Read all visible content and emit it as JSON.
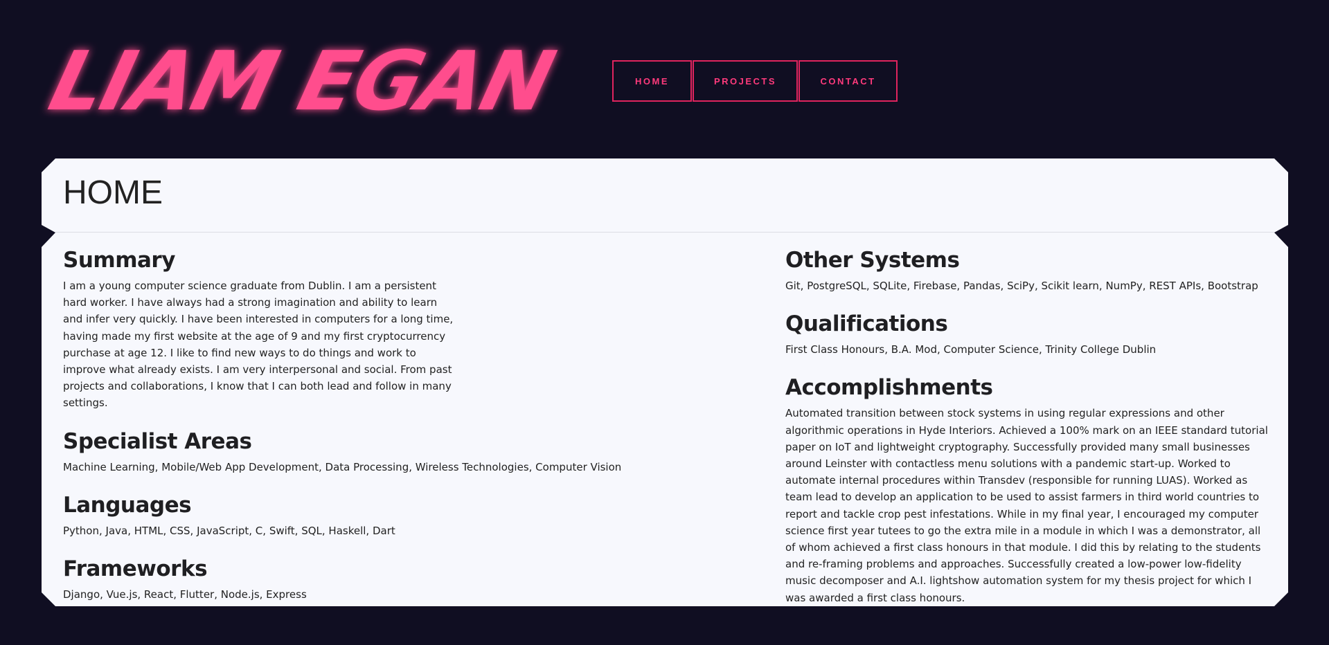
{
  "brand": {
    "logo_text": "LIAM EGAN",
    "logo_color": "#ff4d8d"
  },
  "nav": {
    "items": [
      {
        "label": "HOME"
      },
      {
        "label": "PROJECTS"
      },
      {
        "label": "CONTACT"
      }
    ],
    "accent": "#e0245e"
  },
  "page": {
    "title": "HOME"
  },
  "sections": {
    "summary": {
      "heading": "Summary",
      "text": "I am a young computer science graduate from Dublin. I am a persistent hard worker. I have always had a strong imagination and ability to learn and infer very quickly. I have been interested in computers for a long time, having made my first website at the age of 9 and my first cryptocurrency purchase at age 12. I like to find new ways to do things and work to improve what already exists. I am very interpersonal and social. From past projects and collaborations, I know that I can both lead and follow in many settings."
    },
    "specialist": {
      "heading": "Specialist Areas",
      "text": "Machine Learning, Mobile/Web App Development, Data Processing, Wireless Technologies, Computer Vision"
    },
    "languages": {
      "heading": "Languages",
      "text": "Python, Java, HTML, CSS, JavaScript, C, Swift, SQL, Haskell, Dart"
    },
    "frameworks": {
      "heading": "Frameworks",
      "text": "Django, Vue.js, React, Flutter, Node.js, Express"
    },
    "other_systems": {
      "heading": "Other Systems",
      "text": "Git, PostgreSQL, SQLite, Firebase, Pandas, SciPy, Scikit learn, NumPy, REST APIs, Bootstrap"
    },
    "qualifications": {
      "heading": "Qualifications",
      "text": "First Class Honours, B.A. Mod, Computer Science, Trinity College Dublin"
    },
    "accomplishments": {
      "heading": "Accomplishments",
      "text": "Automated transition between stock systems in using regular expressions and other algorithmic operations in Hyde Interiors. Achieved a 100% mark on an IEEE standard tutorial paper on IoT and lightweight cryptography. Successfully provided many small businesses around Leinster with contactless menu solutions with a pandemic start-up. Worked to automate internal procedures within Transdev (responsible for running LUAS). Worked as team lead to develop an application to be used to assist farmers in third world countries to report and tackle crop pest infestations. While in my final year, I encouraged my computer science first year tutees to go the extra mile in a module in which I was a demonstrator, all of whom achieved a first class honours in that module. I did this by relating to the students and re-framing problems and approaches. Successfully created a low-power low-fidelity music decomposer and A.I. lightshow automation system for my thesis project for which I was awarded a first class honours."
    }
  }
}
